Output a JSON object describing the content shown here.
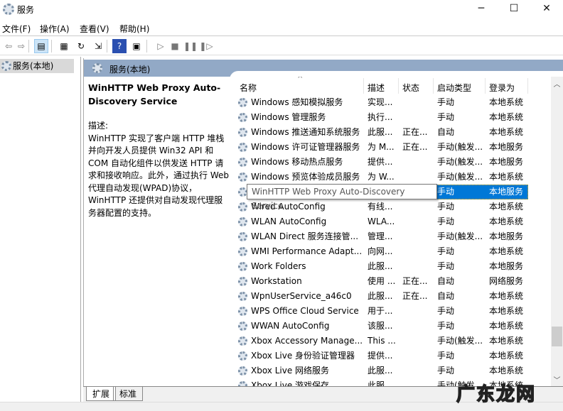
{
  "window": {
    "title": "服务",
    "minimize": "─",
    "maximize": "☐",
    "close": "✕"
  },
  "menu": [
    "文件(F)",
    "操作(A)",
    "查看(V)",
    "帮助(H)"
  ],
  "toolbar": [
    {
      "name": "back-icon",
      "glyph": "⇦"
    },
    {
      "name": "forward-icon",
      "glyph": "⇨"
    },
    {
      "name": "show-hide-console-tree-icon",
      "glyph": "▤"
    },
    {
      "name": "properties-icon",
      "glyph": "▦"
    },
    {
      "name": "refresh-icon",
      "glyph": "↻"
    },
    {
      "name": "export-list-icon",
      "glyph": "⇲"
    },
    {
      "name": "help-icon",
      "glyph": "?"
    },
    {
      "name": "show-action-pane-icon",
      "glyph": "▣"
    },
    {
      "name": "start-service-icon",
      "glyph": "▷"
    },
    {
      "name": "stop-service-icon",
      "glyph": "■"
    },
    {
      "name": "pause-service-icon",
      "glyph": "❚❚"
    },
    {
      "name": "restart-service-icon",
      "glyph": "❚▷"
    }
  ],
  "tree": {
    "root": "服务(本地)"
  },
  "panel": {
    "title": "服务(本地)"
  },
  "detail": {
    "name": "WinHTTP Web Proxy Auto-Discovery Service",
    "desc_label": "描述:",
    "desc": "WinHTTP 实现了客户端 HTTP 堆栈并向开发人员提供 Win32 API 和 COM 自动化组件以供发送 HTTP 请求和接收响应。此外，通过执行 Web 代理自动发现(WPAD)协议，WinHTTP 还提供对自动发现代理服务器配置的支持。"
  },
  "columns": [
    "名称",
    "描述",
    "状态",
    "启动类型",
    "登录为"
  ],
  "rows": [
    [
      "Windows 感知模拟服务",
      "实现...",
      "",
      "手动",
      "本地系统"
    ],
    [
      "Windows 管理服务",
      "执行...",
      "",
      "手动",
      "本地系统"
    ],
    [
      "Windows 推送通知系统服务",
      "此服...",
      "正在...",
      "自动",
      "本地系统"
    ],
    [
      "Windows 许可证管理器服务",
      "为 M...",
      "正在...",
      "手动(触发...",
      "本地服务"
    ],
    [
      "Windows 移动热点服务",
      "提供...",
      "",
      "手动(触发...",
      "本地服务"
    ],
    [
      "Windows 预览体验成员服务",
      "为 W...",
      "",
      "手动(触发...",
      "本地系统"
    ],
    [
      "WinHTTP Web Proxy Auto-Discovery Service",
      "",
      "",
      "手动",
      "本地服务"
    ],
    [
      "Wired AutoConfig",
      "有线...",
      "",
      "手动",
      "本地系统"
    ],
    [
      "WLAN AutoConfig",
      "WLA...",
      "",
      "手动",
      "本地系统"
    ],
    [
      "WLAN Direct 服务连接管...",
      "管理...",
      "",
      "手动(触发...",
      "本地服务"
    ],
    [
      "WMI Performance Adapt...",
      "向网...",
      "",
      "手动",
      "本地系统"
    ],
    [
      "Work Folders",
      "此服...",
      "",
      "手动",
      "本地服务"
    ],
    [
      "Workstation",
      "使用 ...",
      "正在...",
      "自动",
      "网络服务"
    ],
    [
      "WpnUserService_a46c0",
      "此服...",
      "正在...",
      "自动",
      "本地系统"
    ],
    [
      "WPS Office Cloud Service",
      "用于...",
      "",
      "手动",
      "本地系统"
    ],
    [
      "WWAN AutoConfig",
      "该服...",
      "",
      "手动",
      "本地系统"
    ],
    [
      "Xbox Accessory Manage...",
      "This ...",
      "",
      "手动(触发...",
      "本地系统"
    ],
    [
      "Xbox Live 身份验证管理器",
      "提供...",
      "",
      "手动",
      "本地系统"
    ],
    [
      "Xbox Live 网络服务",
      "此服...",
      "",
      "手动",
      "本地系统"
    ],
    [
      "Xbox Live 游戏保存",
      "此服...",
      "",
      "手动(触发...",
      "本地系统"
    ]
  ],
  "selected_index": 6,
  "tooltip": "WinHTTP Web Proxy Auto-Discovery Service",
  "tabs": [
    "扩展",
    "标准"
  ],
  "watermark": "广东龙网",
  "colors": {
    "header": "#92a9c6",
    "selection": "#0078d7"
  }
}
